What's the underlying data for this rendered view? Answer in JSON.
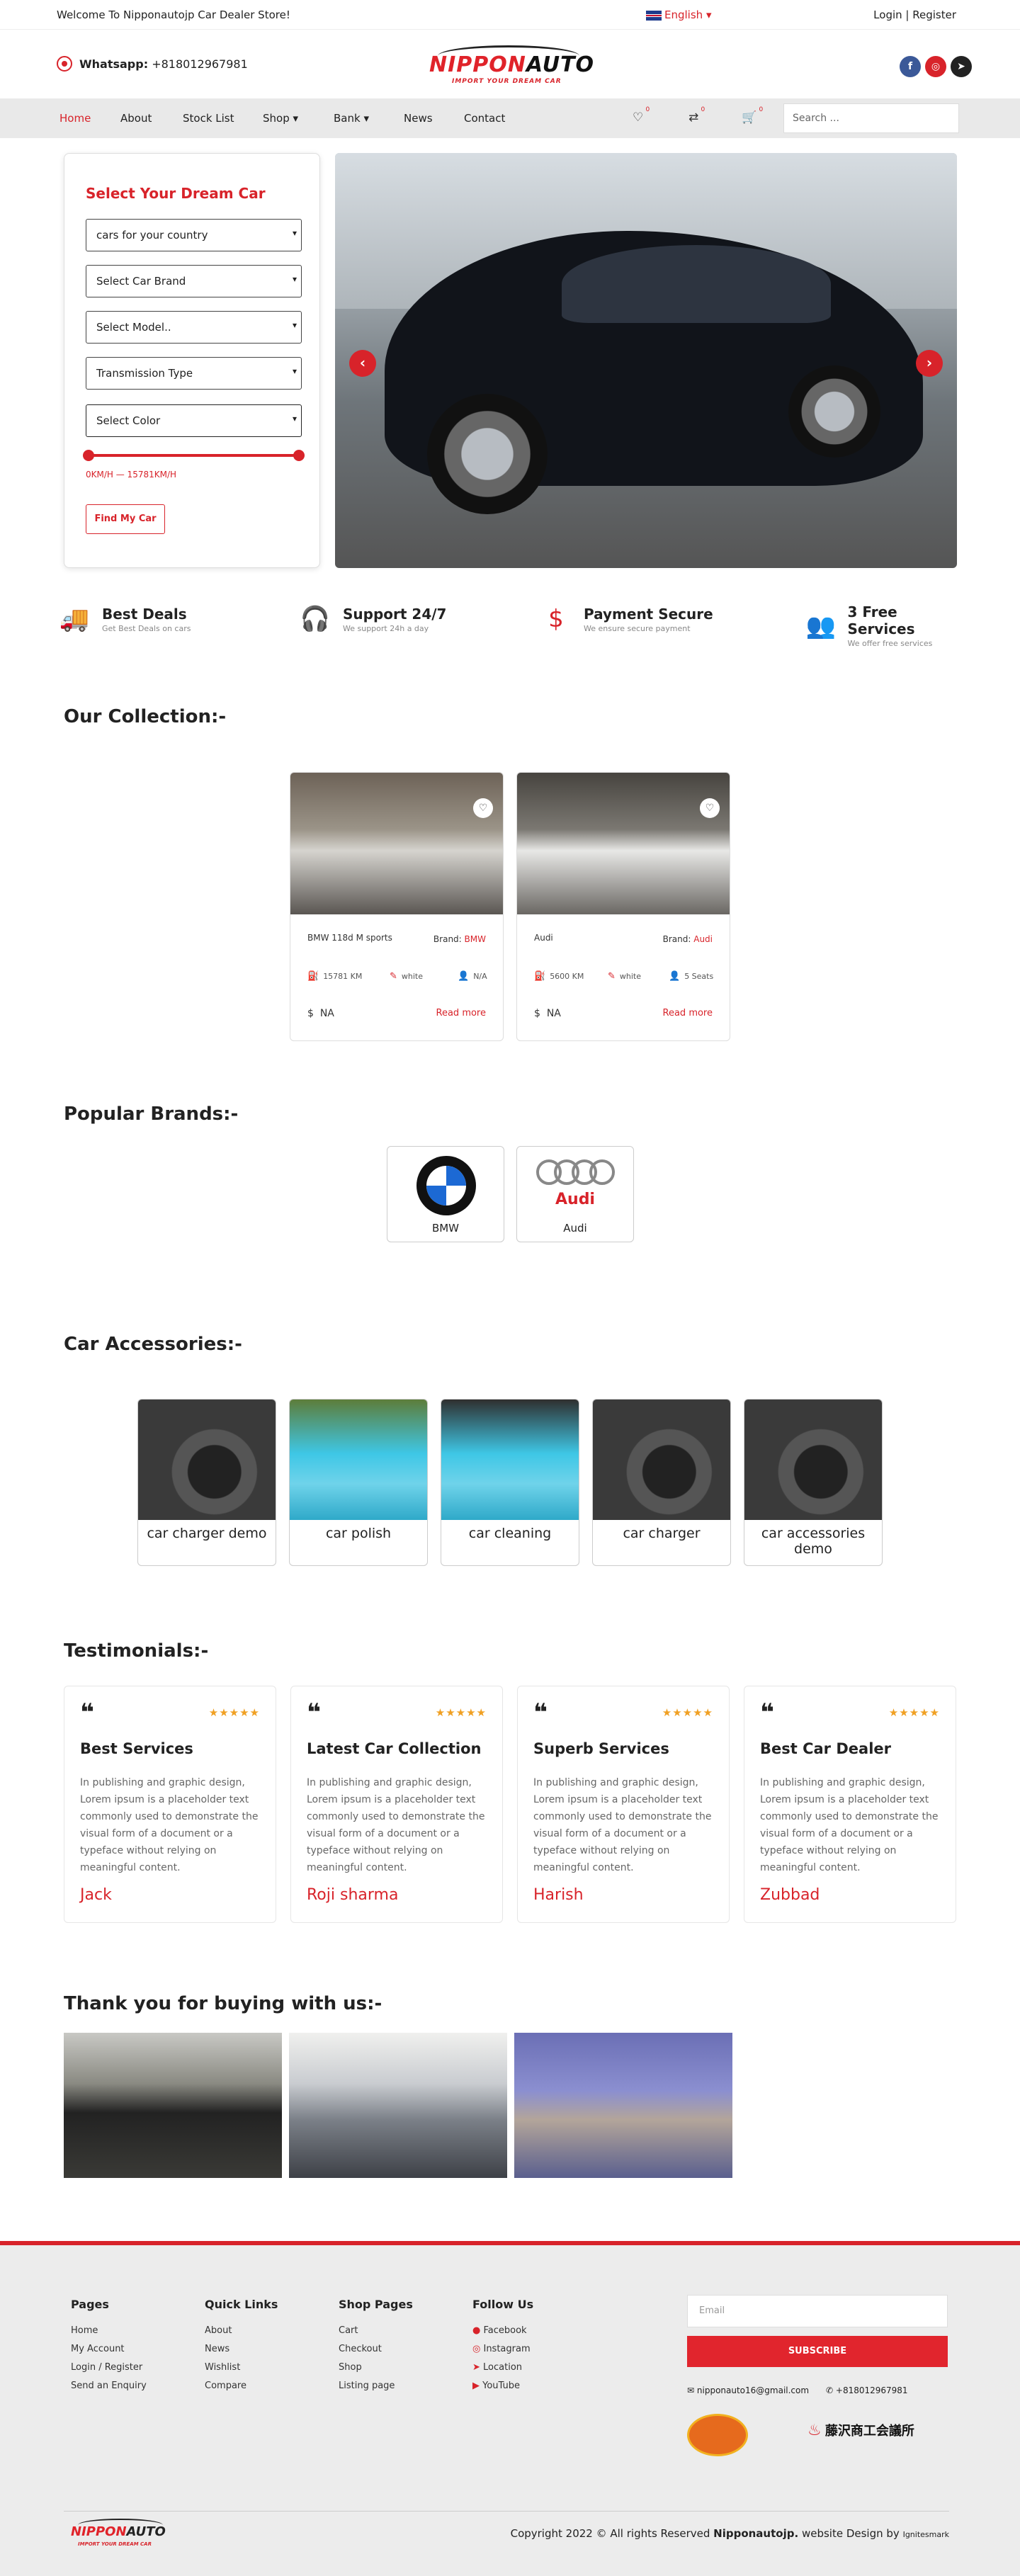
{
  "topbar": {
    "welcome": "Welcome To Nipponautojp Car Dealer Store!",
    "language": "English",
    "login": "Login | Register"
  },
  "header": {
    "whatsapp_label": "Whatsapp:",
    "whatsapp_number": "+818012967981",
    "logo_part1": "NIPPON",
    "logo_part2": "AUTO",
    "logo_tagline": "IMPORT YOUR DREAM CAR"
  },
  "nav": {
    "items": [
      "Home",
      "About",
      "Stock List",
      "Shop",
      "Bank",
      "News",
      "Contact"
    ],
    "wishlist_count": "0",
    "compare_count": "0",
    "cart_count": "0",
    "search_placeholder": "Search ..."
  },
  "finder": {
    "title": "Select Your Dream Car",
    "country": "cars for your country",
    "brand": "Select Car Brand",
    "model": "Select Model..",
    "transmission": "Transmission Type",
    "color": "Select Color",
    "range_text": "0KM/H — 15781KM/H",
    "button": "Find My Car"
  },
  "slider": {
    "prev": "‹",
    "next": "›"
  },
  "features": [
    {
      "title": "Best Deals",
      "sub": "Get Best Deals on cars",
      "icon": "truck-icon"
    },
    {
      "title": "Support 24/7",
      "sub": "We support 24h a day",
      "icon": "headset-icon"
    },
    {
      "title": "Payment Secure",
      "sub": "We ensure secure payment",
      "icon": "payment-icon"
    },
    {
      "title": "3 Free Services",
      "sub": "We offer free services",
      "icon": "service-icon"
    }
  ],
  "collection": {
    "title": "Our Collection:-",
    "cars": [
      {
        "name": "BMW 118d M sports",
        "brand_label": "Brand:",
        "brand": "BMW",
        "km": "15781 KM",
        "color": "white",
        "seats": "N/A",
        "price": "NA",
        "more": "Read more"
      },
      {
        "name": "Audi",
        "brand_label": "Brand:",
        "brand": "Audi",
        "km": "5600 KM",
        "color": "white",
        "seats": "5 Seats",
        "price": "NA",
        "more": "Read more"
      }
    ]
  },
  "brands": {
    "title": "Popular Brands:-",
    "items": [
      "BMW",
      "Audi"
    ]
  },
  "accessories": {
    "title": "Car Accessories:-",
    "items": [
      "car charger demo",
      "car polish",
      "car cleaning",
      "car charger",
      "car accessories demo"
    ]
  },
  "testimonials": {
    "title": "Testimonials:-",
    "stars": "★★★★★",
    "items": [
      {
        "title": "Best Services",
        "body": "In publishing and graphic design, Lorem ipsum is a placeholder text commonly used to demonstrate the visual form of a document or a typeface without relying on meaningful content.",
        "name": "Jack"
      },
      {
        "title": "Latest Car Collection",
        "body": "In publishing and graphic design, Lorem ipsum is a placeholder text commonly used to demonstrate the visual form of a document or a typeface without relying on meaningful content.",
        "name": "Roji sharma"
      },
      {
        "title": "Superb Services",
        "body": "In publishing and graphic design, Lorem ipsum is a placeholder text commonly used to demonstrate the visual form of a document or a typeface without relying on meaningful content.",
        "name": "Harish"
      },
      {
        "title": "Best Car Dealer",
        "body": "In publishing and graphic design, Lorem ipsum is a placeholder text commonly used to demonstrate the visual form of a document or a typeface without relying on meaningful content.",
        "name": "Zubbad"
      }
    ]
  },
  "thanks": {
    "title": "Thank you for buying with us:-"
  },
  "footer": {
    "pages": {
      "title": "Pages",
      "links": [
        "Home",
        "My Account",
        "Login / Register",
        "Send an Enquiry"
      ]
    },
    "quick": {
      "title": "Quick Links",
      "links": [
        "About",
        "News",
        "Wishlist",
        "Compare"
      ]
    },
    "shop": {
      "title": "Shop Pages",
      "links": [
        "Cart",
        "Checkout",
        "Shop",
        "Listing page"
      ]
    },
    "follow": {
      "title": "Follow Us",
      "links": [
        "Facebook",
        "Instagram",
        "Location",
        "YouTube"
      ]
    },
    "email_placeholder": "Email",
    "subscribe": "SUBSCRIBE",
    "contact_email": "nipponauto16@gmail.com",
    "contact_phone": "+818012967981",
    "copyright_prefix": "Copyright 2022 © All rights Reserved",
    "copyright_brand": "Nipponautojp.",
    "copyright_suffix": "website Design by",
    "designer": "Ignitesmark",
    "badge2_text": "藤沢商工会議所"
  }
}
